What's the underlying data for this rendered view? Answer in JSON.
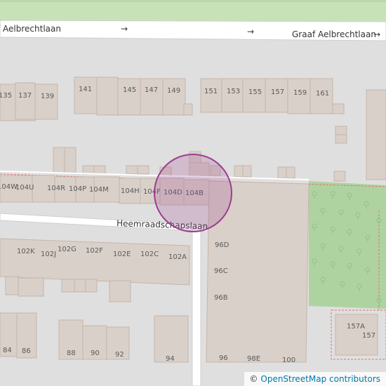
{
  "map": {
    "streets": {
      "main": "Graaf Aelbrechtlaan",
      "main_left_truncated": "f Aelbrechtlaan",
      "side": "Heemraadschapslaan"
    },
    "house_numbers": {
      "row_north": [
        "135",
        "137",
        "139",
        "141",
        "145",
        "147",
        "149",
        "151",
        "153",
        "155",
        "157",
        "159",
        "161"
      ],
      "row_104": [
        "104W",
        "104U",
        "104R",
        "104P",
        "104M",
        "104H",
        "104F",
        "104D",
        "104B"
      ],
      "row_102": [
        "102K",
        "102J",
        "102G",
        "102F",
        "102E",
        "102C",
        "102A"
      ],
      "block_96": [
        "96D",
        "96C",
        "96B"
      ],
      "row_south": [
        "84",
        "86",
        "88",
        "90",
        "92",
        "94",
        "96",
        "98E",
        "100"
      ],
      "plot_157": [
        "157A",
        "157"
      ]
    },
    "highlight": {
      "shape": "circle",
      "color": "#9b3f8f"
    },
    "colors": {
      "background": "#e0dfdf",
      "building": "#d9d0c9",
      "road": "#ffffff",
      "park": "#aed3a0",
      "canal_bank": "#c8e2b8",
      "boundary": "#e07070"
    },
    "arrows": [
      "→",
      "→",
      "→"
    ]
  },
  "attribution": {
    "symbol": "©",
    "text": "OpenStreetMap contributors"
  }
}
